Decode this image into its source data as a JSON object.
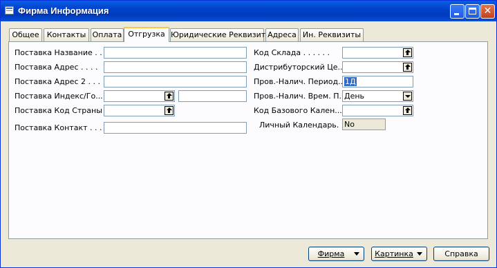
{
  "window": {
    "title": "Фирма Информация"
  },
  "tabs": [
    "Общее",
    "Контакты",
    "Оплата",
    "Отгрузка",
    "Юридические Реквизиты",
    "Адреса",
    "Ин. Реквизиты"
  ],
  "active_tab": "Отгрузка",
  "left_fields": [
    {
      "label": "Поставка Название . . .",
      "value": ""
    },
    {
      "label": "Поставка Адрес . . . .",
      "value": ""
    },
    {
      "label": "Поставка Адрес 2 . . .",
      "value": ""
    },
    {
      "label": "Поставка Индекс/Го...",
      "value": "",
      "value2": ""
    },
    {
      "label": "Поставка Код Страны .",
      "value": ""
    },
    {
      "label": "Поставка Контакт . . .",
      "value": ""
    }
  ],
  "right_fields": [
    {
      "label": "Код Склада . . . . . .",
      "value": ""
    },
    {
      "label": "Дистрибуторский Це...",
      "value": ""
    },
    {
      "label": "Пров.-Налич. Период...",
      "value": "1Д"
    },
    {
      "label": "Пров.-Налич. Врем. П...",
      "value": "День"
    },
    {
      "label": "Код Базового Кален...",
      "value": ""
    },
    {
      "label": "Личный Календарь. .",
      "value": "No"
    }
  ],
  "buttons": {
    "firm": "Фирма",
    "picture": "Картинка",
    "help": "Справка"
  },
  "icons": {
    "window": "app-window-icon",
    "lookup": "lookup-arrow-icon",
    "dropdown": "dropdown-arrow-icon"
  }
}
